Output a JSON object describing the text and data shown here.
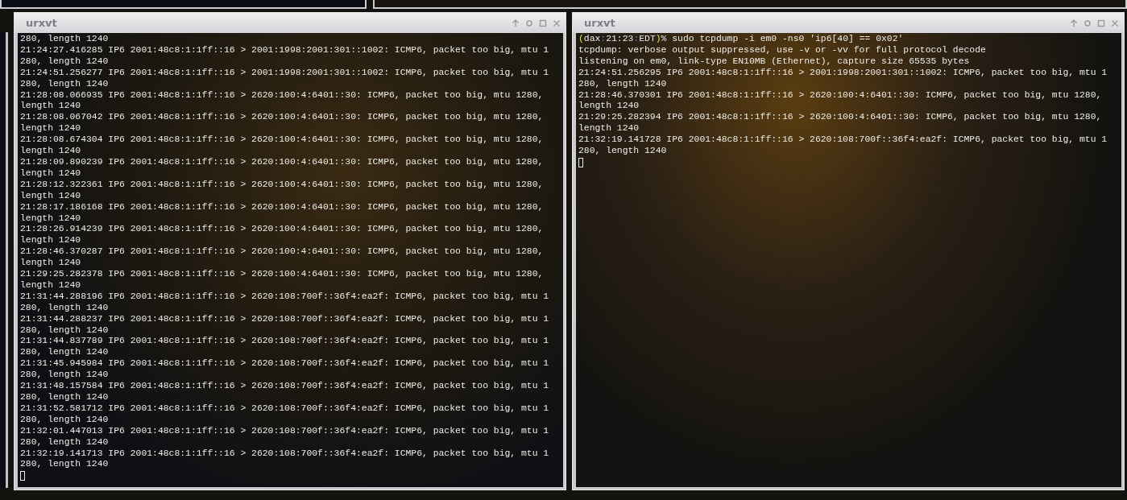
{
  "windows": [
    {
      "title": "urxvt",
      "lines": [
        "280, length 1240",
        "21:24:27.416285 IP6 2001:48c8:1:1ff::16 > 2001:1998:2001:301::1002: ICMP6, packet too big, mtu 1",
        "280, length 1240",
        "21:24:51.256277 IP6 2001:48c8:1:1ff::16 > 2001:1998:2001:301::1002: ICMP6, packet too big, mtu 1",
        "280, length 1240",
        "21:28:08.066935 IP6 2001:48c8:1:1ff::16 > 2620:100:4:6401::30: ICMP6, packet too big, mtu 1280,",
        "length 1240",
        "21:28:08.067042 IP6 2001:48c8:1:1ff::16 > 2620:100:4:6401::30: ICMP6, packet too big, mtu 1280,",
        "length 1240",
        "21:28:08.674304 IP6 2001:48c8:1:1ff::16 > 2620:100:4:6401::30: ICMP6, packet too big, mtu 1280,",
        "length 1240",
        "21:28:09.890239 IP6 2001:48c8:1:1ff::16 > 2620:100:4:6401::30: ICMP6, packet too big, mtu 1280,",
        "length 1240",
        "21:28:12.322361 IP6 2001:48c8:1:1ff::16 > 2620:100:4:6401::30: ICMP6, packet too big, mtu 1280,",
        "length 1240",
        "21:28:17.186168 IP6 2001:48c8:1:1ff::16 > 2620:100:4:6401::30: ICMP6, packet too big, mtu 1280,",
        "length 1240",
        "21:28:26.914239 IP6 2001:48c8:1:1ff::16 > 2620:100:4:6401::30: ICMP6, packet too big, mtu 1280,",
        "length 1240",
        "21:28:46.370287 IP6 2001:48c8:1:1ff::16 > 2620:100:4:6401::30: ICMP6, packet too big, mtu 1280,",
        "length 1240",
        "21:29:25.282378 IP6 2001:48c8:1:1ff::16 > 2620:100:4:6401::30: ICMP6, packet too big, mtu 1280,",
        "length 1240",
        "21:31:44.288196 IP6 2001:48c8:1:1ff::16 > 2620:108:700f::36f4:ea2f: ICMP6, packet too big, mtu 1",
        "280, length 1240",
        "21:31:44.288237 IP6 2001:48c8:1:1ff::16 > 2620:108:700f::36f4:ea2f: ICMP6, packet too big, mtu 1",
        "280, length 1240",
        "21:31:44.837789 IP6 2001:48c8:1:1ff::16 > 2620:108:700f::36f4:ea2f: ICMP6, packet too big, mtu 1",
        "280, length 1240",
        "21:31:45.945984 IP6 2001:48c8:1:1ff::16 > 2620:108:700f::36f4:ea2f: ICMP6, packet too big, mtu 1",
        "280, length 1240",
        "21:31:48.157584 IP6 2001:48c8:1:1ff::16 > 2620:108:700f::36f4:ea2f: ICMP6, packet too big, mtu 1",
        "280, length 1240",
        "21:31:52.581712 IP6 2001:48c8:1:1ff::16 > 2620:108:700f::36f4:ea2f: ICMP6, packet too big, mtu 1",
        "280, length 1240",
        "21:32:01.447013 IP6 2001:48c8:1:1ff::16 > 2620:108:700f::36f4:ea2f: ICMP6, packet too big, mtu 1",
        "280, length 1240",
        "21:32:19.141713 IP6 2001:48c8:1:1ff::16 > 2620:108:700f::36f4:ea2f: ICMP6, packet too big, mtu 1",
        "280, length 1240"
      ]
    },
    {
      "title": "urxvt",
      "prompt": {
        "segments": [
          {
            "text": "(",
            "kind": "bracket"
          },
          {
            "text": "dax",
            "kind": "plain"
          },
          {
            "text": ":",
            "kind": "separator"
          },
          {
            "text": "21:23",
            "kind": "plain"
          },
          {
            "text": ":",
            "kind": "separator"
          },
          {
            "text": "EDT",
            "kind": "plain"
          },
          {
            "text": ")",
            "kind": "bracket"
          },
          {
            "text": "% sudo tcpdump -i em0 -ns0 'ip6[40] == 0x02'",
            "kind": "plain"
          }
        ]
      },
      "lines": [
        "tcpdump: verbose output suppressed, use -v or -vv for full protocol decode",
        "listening on em0, link-type EN10MB (Ethernet), capture size 65535 bytes",
        "21:24:51.256295 IP6 2001:48c8:1:1ff::16 > 2001:1998:2001:301::1002: ICMP6, packet too big, mtu 1",
        "280, length 1240",
        "21:28:46.370301 IP6 2001:48c8:1:1ff::16 > 2620:100:4:6401::30: ICMP6, packet too big, mtu 1280,",
        "length 1240",
        "21:29:25.282394 IP6 2001:48c8:1:1ff::16 > 2620:100:4:6401::30: ICMP6, packet too big, mtu 1280,",
        "length 1240",
        "21:32:19.141728 IP6 2001:48c8:1:1ff::16 > 2620:108:700f::36f4:ea2f: ICMP6, packet too big, mtu 1",
        "280, length 1240"
      ]
    }
  ]
}
